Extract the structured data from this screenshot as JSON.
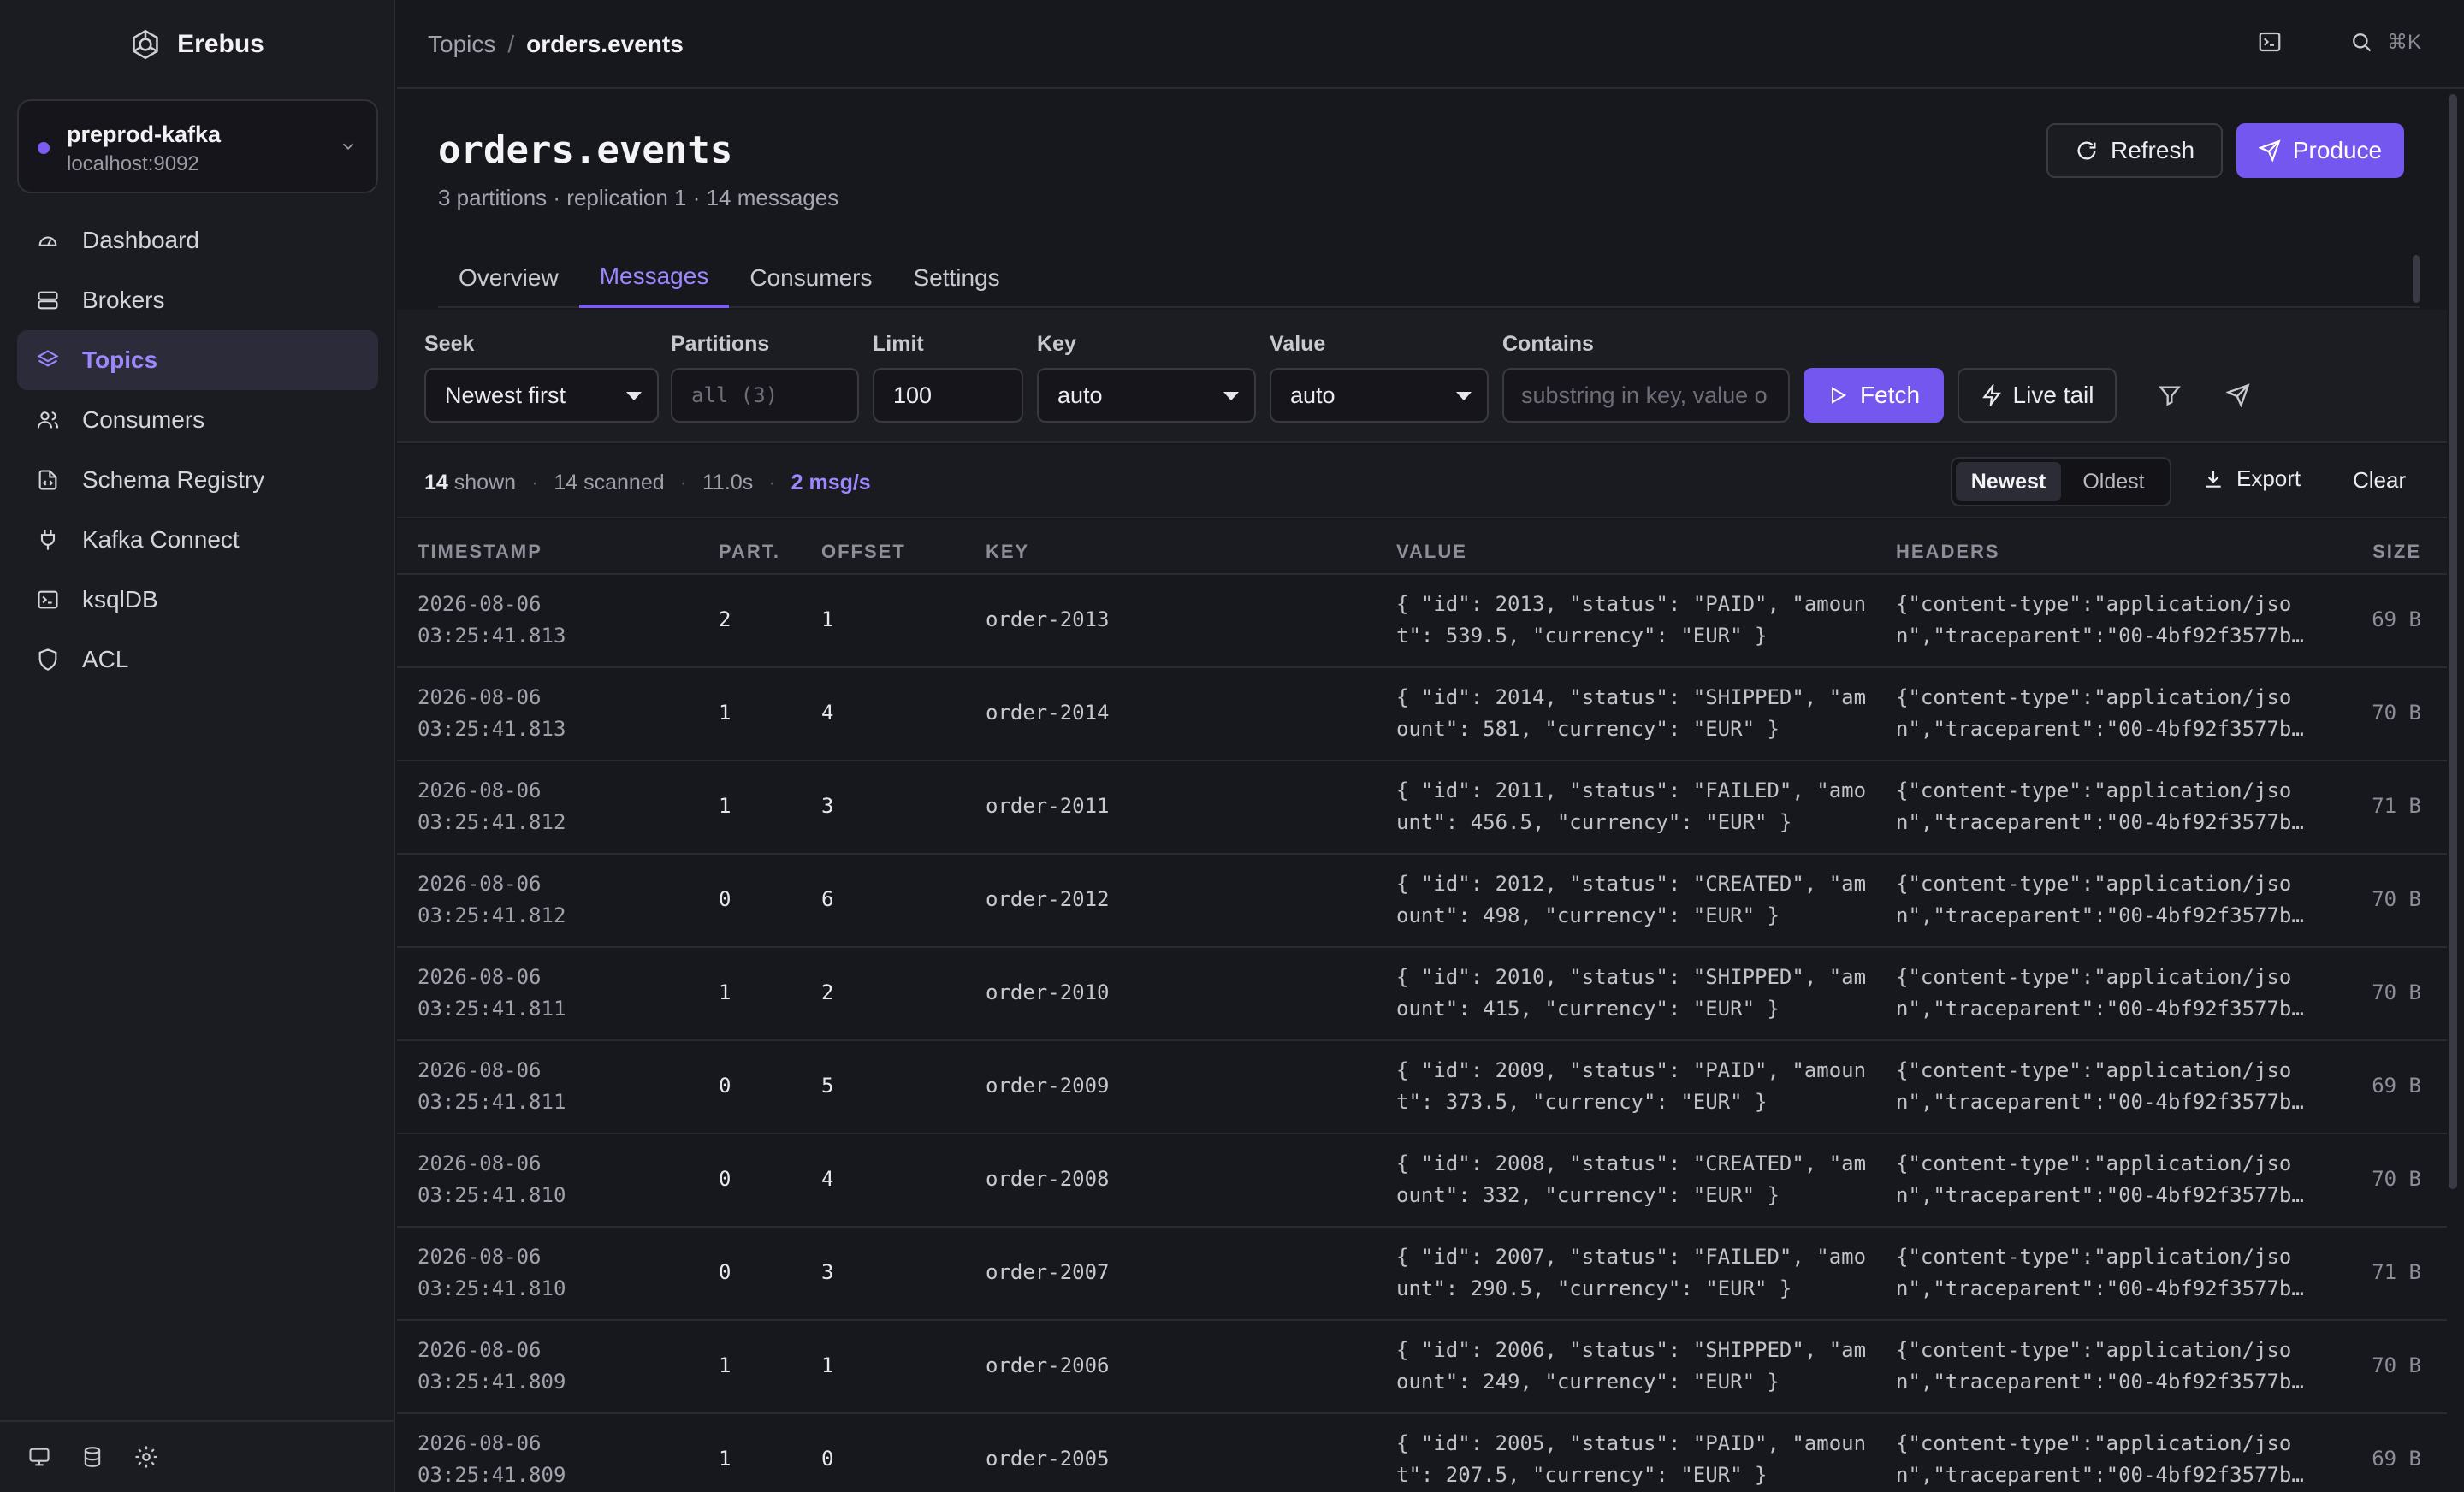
{
  "app": {
    "name": "Erebus"
  },
  "cluster": {
    "name": "preprod-kafka",
    "host": "localhost:9092",
    "status_color": "#7c5cf0"
  },
  "nav": [
    {
      "label": "Dashboard",
      "icon": "gauge-icon"
    },
    {
      "label": "Brokers",
      "icon": "server-icon"
    },
    {
      "label": "Topics",
      "icon": "layers-icon",
      "active": true
    },
    {
      "label": "Consumers",
      "icon": "users-icon"
    },
    {
      "label": "Schema Registry",
      "icon": "file-code-icon"
    },
    {
      "label": "Kafka Connect",
      "icon": "plug-icon"
    },
    {
      "label": "ksqlDB",
      "icon": "terminal-icon"
    },
    {
      "label": "ACL",
      "icon": "shield-icon"
    }
  ],
  "breadcrumb": {
    "parent": "Topics",
    "separator": "/",
    "current": "orders.events"
  },
  "topbar": {
    "shortcut": "⌘K"
  },
  "topic": {
    "title": "orders.events",
    "meta": "3 partitions · replication 1 · 14 messages",
    "refresh_label": "Refresh",
    "produce_label": "Produce"
  },
  "tabs": [
    "Overview",
    "Messages",
    "Consumers",
    "Settings"
  ],
  "active_tab": "Messages",
  "filters": {
    "seek_label": "Seek",
    "seek_value": "Newest first",
    "partitions_label": "Partitions",
    "partitions_placeholder": "all (3)",
    "limit_label": "Limit",
    "limit_value": "100",
    "key_label": "Key",
    "key_value": "auto",
    "value_label": "Value",
    "value_value": "auto",
    "contains_label": "Contains",
    "contains_placeholder": "substring in key, value o",
    "fetch_label": "Fetch",
    "live_label": "Live tail"
  },
  "status": {
    "shown_count": "14",
    "shown_label": "shown",
    "scanned": "14 scanned",
    "duration": "11.0s",
    "rate": "2 msg/s",
    "sort_newest": "Newest",
    "sort_oldest": "Oldest",
    "export_label": "Export",
    "clear_label": "Clear"
  },
  "columns": [
    "TIMESTAMP",
    "PART.",
    "OFFSET",
    "KEY",
    "VALUE",
    "HEADERS",
    "SIZE"
  ],
  "rows": [
    {
      "date": "2026-08-06",
      "time": "03:25:41.813",
      "part": "2",
      "offset": "1",
      "key": "order-2013",
      "value": "{ \"id\": 2013, \"status\": \"PAID\", \"amount\": 539.5, \"currency\": \"EUR\" }",
      "headers_1": "{\"content-type\":\"application/jso",
      "headers_2": "n\",\"traceparent\":\"00-4bf92f3577b…",
      "size": "69 B"
    },
    {
      "date": "2026-08-06",
      "time": "03:25:41.813",
      "part": "1",
      "offset": "4",
      "key": "order-2014",
      "value": "{ \"id\": 2014, \"status\": \"SHIPPED\", \"amount\": 581, \"currency\": \"EUR\" }",
      "headers_1": "{\"content-type\":\"application/jso",
      "headers_2": "n\",\"traceparent\":\"00-4bf92f3577b…",
      "size": "70 B"
    },
    {
      "date": "2026-08-06",
      "time": "03:25:41.812",
      "part": "1",
      "offset": "3",
      "key": "order-2011",
      "value": "{ \"id\": 2011, \"status\": \"FAILED\", \"amount\": 456.5, \"currency\": \"EUR\" }",
      "headers_1": "{\"content-type\":\"application/jso",
      "headers_2": "n\",\"traceparent\":\"00-4bf92f3577b…",
      "size": "71 B"
    },
    {
      "date": "2026-08-06",
      "time": "03:25:41.812",
      "part": "0",
      "offset": "6",
      "key": "order-2012",
      "value": "{ \"id\": 2012, \"status\": \"CREATED\", \"amount\": 498, \"currency\": \"EUR\" }",
      "headers_1": "{\"content-type\":\"application/jso",
      "headers_2": "n\",\"traceparent\":\"00-4bf92f3577b…",
      "size": "70 B"
    },
    {
      "date": "2026-08-06",
      "time": "03:25:41.811",
      "part": "1",
      "offset": "2",
      "key": "order-2010",
      "value": "{ \"id\": 2010, \"status\": \"SHIPPED\", \"amount\": 415, \"currency\": \"EUR\" }",
      "headers_1": "{\"content-type\":\"application/jso",
      "headers_2": "n\",\"traceparent\":\"00-4bf92f3577b…",
      "size": "70 B"
    },
    {
      "date": "2026-08-06",
      "time": "03:25:41.811",
      "part": "0",
      "offset": "5",
      "key": "order-2009",
      "value": "{ \"id\": 2009, \"status\": \"PAID\", \"amount\": 373.5, \"currency\": \"EUR\" }",
      "headers_1": "{\"content-type\":\"application/jso",
      "headers_2": "n\",\"traceparent\":\"00-4bf92f3577b…",
      "size": "69 B"
    },
    {
      "date": "2026-08-06",
      "time": "03:25:41.810",
      "part": "0",
      "offset": "4",
      "key": "order-2008",
      "value": "{ \"id\": 2008, \"status\": \"CREATED\", \"amount\": 332, \"currency\": \"EUR\" }",
      "headers_1": "{\"content-type\":\"application/jso",
      "headers_2": "n\",\"traceparent\":\"00-4bf92f3577b…",
      "size": "70 B"
    },
    {
      "date": "2026-08-06",
      "time": "03:25:41.810",
      "part": "0",
      "offset": "3",
      "key": "order-2007",
      "value": "{ \"id\": 2007, \"status\": \"FAILED\", \"amount\": 290.5, \"currency\": \"EUR\" }",
      "headers_1": "{\"content-type\":\"application/jso",
      "headers_2": "n\",\"traceparent\":\"00-4bf92f3577b…",
      "size": "71 B"
    },
    {
      "date": "2026-08-06",
      "time": "03:25:41.809",
      "part": "1",
      "offset": "1",
      "key": "order-2006",
      "value": "{ \"id\": 2006, \"status\": \"SHIPPED\", \"amount\": 249, \"currency\": \"EUR\" }",
      "headers_1": "{\"content-type\":\"application/jso",
      "headers_2": "n\",\"traceparent\":\"00-4bf92f3577b…",
      "size": "70 B"
    },
    {
      "date": "2026-08-06",
      "time": "03:25:41.809",
      "part": "1",
      "offset": "0",
      "key": "order-2005",
      "value": "{ \"id\": 2005, \"status\": \"PAID\", \"amount\": 207.5, \"currency\": \"EUR\" }",
      "headers_1": "{\"content-type\":\"application/jso",
      "headers_2": "n\",\"traceparent\":\"00-4bf92f3577b…",
      "size": "69 B"
    }
  ],
  "colors": {
    "accent": "#7457ee",
    "accent_text": "#9d87ff",
    "background": "#17171e",
    "sidebar": "#1b1b22"
  }
}
